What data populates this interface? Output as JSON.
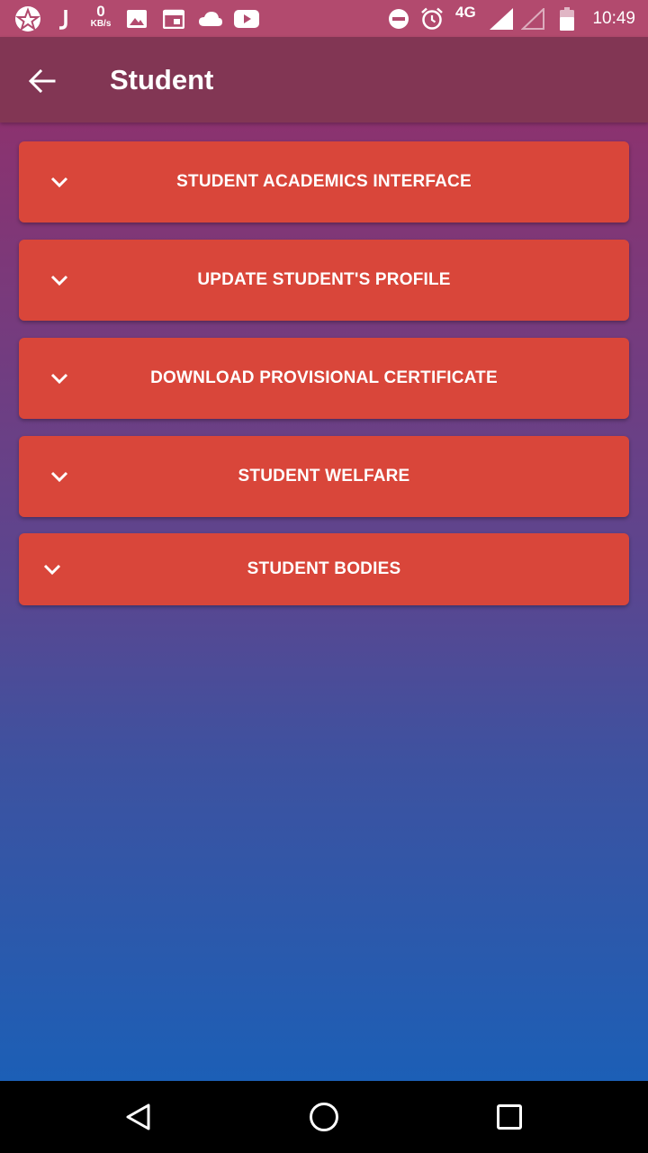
{
  "status_bar": {
    "speed_value": "0",
    "speed_unit": "KB/s",
    "network": "4G",
    "time": "10:49",
    "icons": [
      "app-logo-icon",
      "j-app-icon",
      "image-icon",
      "calendar-icon",
      "cloud-icon",
      "youtube-icon",
      "do-not-disturb-icon",
      "alarm-icon",
      "signal-icon",
      "signal-empty-icon",
      "battery-icon"
    ]
  },
  "app_bar": {
    "title": "Student",
    "back_icon": "arrow-back-icon"
  },
  "panels": [
    {
      "label": "STUDENT ACADEMICS INTERFACE",
      "icon": "chevron-down-icon"
    },
    {
      "label": "UPDATE STUDENT'S PROFILE",
      "icon": "chevron-down-icon"
    },
    {
      "label": "DOWNLOAD PROVISIONAL CERTIFICATE",
      "icon": "chevron-down-icon"
    },
    {
      "label": "STUDENT WELFARE",
      "icon": "chevron-down-icon"
    },
    {
      "label": "STUDENT BODIES",
      "icon": "chevron-down-icon"
    }
  ],
  "nav_bar": {
    "icons": [
      "nav-back-icon",
      "nav-home-icon",
      "nav-recents-icon"
    ]
  },
  "colors": {
    "status_bar": "#b24a6e",
    "app_bar": "#823654",
    "panel": "#d9463a",
    "gradient_top": "#a02864",
    "gradient_bottom": "#1c5fb6"
  }
}
